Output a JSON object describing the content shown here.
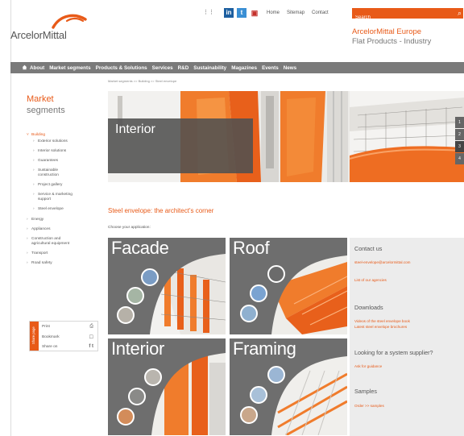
{
  "header": {
    "logo_text": "ArcelorMittal",
    "utility_links": [
      "Home",
      "Sitemap",
      "Contact"
    ],
    "search_placeholder": "Search",
    "region_line1": "ArcelorMittal Europe",
    "region_line2": "Flat Products - Industry"
  },
  "mainnav": {
    "items": [
      "About",
      "Market segments",
      "Products & Solutions",
      "Services",
      "R&D",
      "Sustainability",
      "Magazines",
      "Events",
      "News"
    ]
  },
  "breadcrumb": "Market segments  >>  Building  >>  Steel envelope",
  "sidebar": {
    "title_line1": "Market",
    "title_line2": "segments",
    "items": [
      {
        "label": "Building"
      },
      {
        "label": "Exterior solutions"
      },
      {
        "label": "Interior solutions"
      },
      {
        "label": "Guarantees"
      },
      {
        "label": "Sustainable"
      },
      {
        "label": "construction"
      },
      {
        "label": "Project gallery"
      },
      {
        "label": "Service & marketing"
      },
      {
        "label": "support"
      },
      {
        "label": "Steel envelope"
      },
      {
        "label": "Energy"
      },
      {
        "label": "Appliances"
      },
      {
        "label": "Construction and"
      },
      {
        "label": "agricultural equipment"
      },
      {
        "label": "Transport"
      },
      {
        "label": "Road safety"
      }
    ]
  },
  "share": {
    "tab_label": "Share page",
    "print": "Print",
    "bookmark": "Bookmark",
    "share_on": "Share on"
  },
  "hero": {
    "label": "Interior",
    "pager": [
      "1",
      "2",
      "3",
      "4"
    ]
  },
  "content": {
    "section_title": "Steel envelope: the architect's corner",
    "choose": "Choose your application:",
    "tiles": [
      {
        "label": "Facade"
      },
      {
        "label": "Roof"
      },
      {
        "label": "Interior"
      },
      {
        "label": "Framing"
      }
    ]
  },
  "right_sidebar": {
    "contact_title": "Contact us",
    "contact_email": "steel-envelope@arcelormittal.com",
    "contact_agencies": "List of our agencies",
    "downloads_title": "Downloads",
    "download_1": "Videos of the steel envelope book",
    "download_2": "Latest steel envelope brochures",
    "supplier_title": "Looking for a system supplier?",
    "supplier_link": "Ask for guidance",
    "samples_title": "Samples",
    "samples_link": "Order >> samples"
  },
  "colors": {
    "accent": "#e85a18",
    "nav_bg": "#7a7a7a",
    "sidebar_bg": "#ececec",
    "tile_grey": "#6e6e6e"
  },
  "icons": [
    "home-icon",
    "rss-icon",
    "linkedin-icon",
    "twitter-icon",
    "youtube-icon",
    "search-icon",
    "print-icon",
    "bookmark-icon",
    "share-icon"
  ]
}
